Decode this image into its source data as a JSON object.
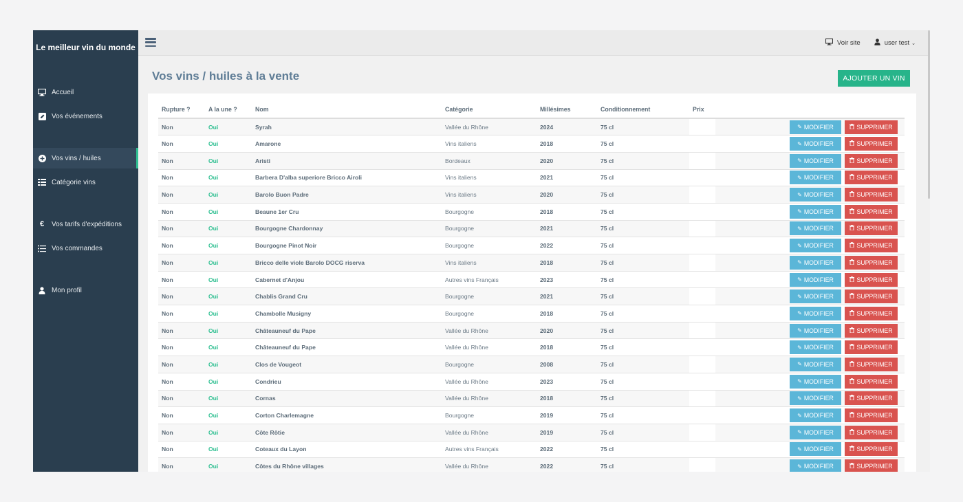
{
  "sidebar": {
    "brand": "Le meilleur vin du monde",
    "items": [
      {
        "label": "Accueil",
        "icon": "monitor-icon"
      },
      {
        "label": "Vos événements",
        "icon": "edit-icon"
      },
      {
        "label": "Vos vins / huiles",
        "icon": "plus-circle-icon",
        "active": true
      },
      {
        "label": "Catégorie vins",
        "icon": "list-icon"
      },
      {
        "label": "Vos tarifs d'expéditions",
        "icon": "euro-icon"
      },
      {
        "label": "Vos commandes",
        "icon": "list-ul-icon"
      },
      {
        "label": "Mon profil",
        "icon": "user-icon"
      }
    ]
  },
  "topbar": {
    "voir_site": "Voir site",
    "user": "user test"
  },
  "main": {
    "title": "Vos vins / huiles à la vente",
    "add_button": "AJOUTER UN VIN",
    "modify_label": "MODIFIER",
    "delete_label": "SUPPRIMER"
  },
  "table": {
    "headers": [
      "Rupture ?",
      "A la une ?",
      "Nom",
      "Catégorie",
      "Millésimes",
      "Conditionnement",
      "Prix"
    ],
    "rows": [
      {
        "rupture": "Non",
        "une": "Oui",
        "nom": "Syrah",
        "categorie": "Vallée du Rhône",
        "millesime": "2024",
        "cond": "75 cl"
      },
      {
        "rupture": "Non",
        "une": "Oui",
        "nom": "Amarone",
        "categorie": "Vins italiens",
        "millesime": "2018",
        "cond": "75 cl"
      },
      {
        "rupture": "Non",
        "une": "Oui",
        "nom": "Aristi",
        "categorie": "Bordeaux",
        "millesime": "2020",
        "cond": "75 cl"
      },
      {
        "rupture": "Non",
        "une": "Oui",
        "nom": "Barbera D'alba superiore Bricco Airoli",
        "categorie": "Vins italiens",
        "millesime": "2021",
        "cond": "75 cl"
      },
      {
        "rupture": "Non",
        "une": "Oui",
        "nom": "Barolo Buon Padre",
        "categorie": "Vins italiens",
        "millesime": "2020",
        "cond": "75 cl"
      },
      {
        "rupture": "Non",
        "une": "Oui",
        "nom": "Beaune 1er Cru",
        "categorie": "Bourgogne",
        "millesime": "2018",
        "cond": "75 cl"
      },
      {
        "rupture": "Non",
        "une": "Oui",
        "nom": "Bourgogne Chardonnay",
        "categorie": "Bourgogne",
        "millesime": "2021",
        "cond": "75 cl"
      },
      {
        "rupture": "Non",
        "une": "Oui",
        "nom": "Bourgogne Pinot Noir",
        "categorie": "Bourgogne",
        "millesime": "2022",
        "cond": "75 cl"
      },
      {
        "rupture": "Non",
        "une": "Oui",
        "nom": "Bricco delle viole Barolo DOCG riserva",
        "categorie": "Vins italiens",
        "millesime": "2018",
        "cond": "75 cl"
      },
      {
        "rupture": "Non",
        "une": "Oui",
        "nom": "Cabernet d'Anjou",
        "categorie": "Autres vins Français",
        "millesime": "2023",
        "cond": "75 cl"
      },
      {
        "rupture": "Non",
        "une": "Oui",
        "nom": "Chablis Grand Cru",
        "categorie": "Bourgogne",
        "millesime": "2021",
        "cond": "75 cl"
      },
      {
        "rupture": "Non",
        "une": "Oui",
        "nom": "Chambolle Musigny",
        "categorie": "Bourgogne",
        "millesime": "2018",
        "cond": "75 cl"
      },
      {
        "rupture": "Non",
        "une": "Oui",
        "nom": "Châteauneuf du Pape",
        "categorie": "Vallée du Rhône",
        "millesime": "2020",
        "cond": "75 cl"
      },
      {
        "rupture": "Non",
        "une": "Oui",
        "nom": "Châteauneuf du Pape",
        "categorie": "Vallée du Rhône",
        "millesime": "2018",
        "cond": "75 cl"
      },
      {
        "rupture": "Non",
        "une": "Oui",
        "nom": "Clos de Vougeot",
        "categorie": "Bourgogne",
        "millesime": "2008",
        "cond": "75 cl"
      },
      {
        "rupture": "Non",
        "une": "Oui",
        "nom": "Condrieu",
        "categorie": "Vallée du Rhône",
        "millesime": "2023",
        "cond": "75 cl"
      },
      {
        "rupture": "Non",
        "une": "Oui",
        "nom": "Cornas",
        "categorie": "Vallée du Rhône",
        "millesime": "2018",
        "cond": "75 cl"
      },
      {
        "rupture": "Non",
        "une": "Oui",
        "nom": "Corton Charlemagne",
        "categorie": "Bourgogne",
        "millesime": "2019",
        "cond": "75 cl"
      },
      {
        "rupture": "Non",
        "une": "Oui",
        "nom": "Côte Rôtie",
        "categorie": "Vallée du Rhône",
        "millesime": "2019",
        "cond": "75 cl"
      },
      {
        "rupture": "Non",
        "une": "Oui",
        "nom": "Coteaux du Layon",
        "categorie": "Autres vins Français",
        "millesime": "2022",
        "cond": "75 cl"
      },
      {
        "rupture": "Non",
        "une": "Oui",
        "nom": "Côtes du Rhône villages",
        "categorie": "Vallée du Rhône",
        "millesime": "2022",
        "cond": "75 cl"
      }
    ]
  }
}
